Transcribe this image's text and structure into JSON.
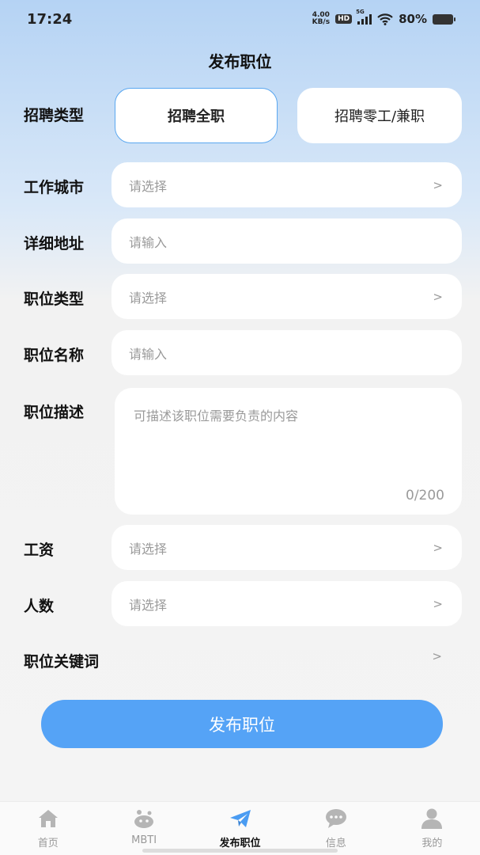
{
  "status_bar": {
    "time": "17:24",
    "speed_value": "4.00",
    "speed_unit": "KB/s",
    "hd": "HD",
    "network": "5G",
    "battery": "80%"
  },
  "page_title": "发布职位",
  "recruit_type": {
    "label": "招聘类型",
    "options": [
      "招聘全职",
      "招聘零工/兼职"
    ],
    "selected_index": 0
  },
  "fields": {
    "city": {
      "label": "工作城市",
      "placeholder": "请选择"
    },
    "address": {
      "label": "详细地址",
      "placeholder": "请输入"
    },
    "position_type": {
      "label": "职位类型",
      "placeholder": "请选择"
    },
    "position_name": {
      "label": "职位名称",
      "placeholder": "请输入"
    },
    "description": {
      "label": "职位描述",
      "placeholder": "可描述该职位需要负责的内容",
      "counter": "0/200"
    },
    "salary": {
      "label": "工资",
      "placeholder": "请选择"
    },
    "headcount": {
      "label": "人数",
      "placeholder": "请选择"
    },
    "keywords": {
      "label": "职位关键词"
    }
  },
  "chevron": ">",
  "submit_label": "发布职位",
  "tabbar": [
    {
      "label": "首页",
      "icon": "home-icon"
    },
    {
      "label": "MBTI",
      "icon": "mbti-icon"
    },
    {
      "label": "发布职位",
      "icon": "send-icon"
    },
    {
      "label": "信息",
      "icon": "chat-icon"
    },
    {
      "label": "我的",
      "icon": "user-icon"
    }
  ],
  "colors": {
    "accent": "#55a3f6",
    "tab_active": "#4a9cf2",
    "tab_inactive": "#b5b5b5"
  }
}
